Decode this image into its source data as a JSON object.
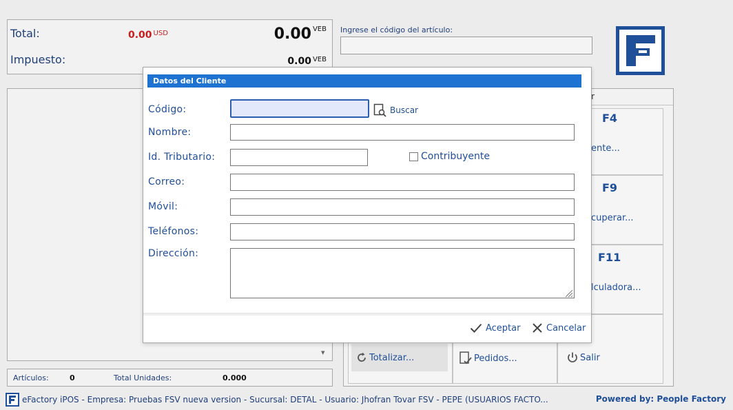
{
  "totals": {
    "total_label": "Total:",
    "total_usd": "0.00",
    "usd_currency": "USD",
    "total_ves": "0.00",
    "ves_currency": "VEB",
    "tax_label": "Impuesto:",
    "tax_ves": "0.00",
    "tax_currency": "VEB"
  },
  "article_search": {
    "label": "Ingrese el código del artículo:",
    "value": ""
  },
  "summary": {
    "articles_label": "Artículos:",
    "articles_value": "0",
    "units_label": "Total Unidades:",
    "units_value": "0.000"
  },
  "fkeys": {
    "header_fragment": "r",
    "items": [
      {
        "key": "F4",
        "action": "ente..."
      },
      {
        "key": "F9",
        "action": "cuperar..."
      },
      {
        "key": "F11",
        "action": "lculadora..."
      }
    ],
    "bottom": {
      "totalize": "Totalizar...",
      "orders": "Pedidos...",
      "exit": "Salir"
    }
  },
  "footer": {
    "status": "eFactory iPOS - Empresa: Pruebas FSV nueva version - Sucursal: DETAL - Usuario: Jhofran Tovar FSV - PEPE (USUARIOS FACTO...",
    "powered": "Powered by: People Factory"
  },
  "dialog": {
    "title": "Datos del Cliente",
    "code_label": "Código:",
    "code_value": "",
    "search_label": "Buscar",
    "name_label": "Nombre:",
    "name_value": "",
    "taxid_label": "Id. Tributario:",
    "taxid_value": "",
    "taxpayer_label": "Contribuyente",
    "taxpayer_checked": false,
    "email_label": "Correo:",
    "email_value": "",
    "mobile_label": "Móvil:",
    "mobile_value": "",
    "phones_label": "Teléfonos:",
    "phones_value": "",
    "address_label": "Dirección:",
    "address_value": "",
    "accept_label": "Aceptar",
    "cancel_label": "Cancelar"
  },
  "colors": {
    "accent": "#1e73d2",
    "brand": "#1f4f99",
    "usd_total": "#c81e1e"
  }
}
